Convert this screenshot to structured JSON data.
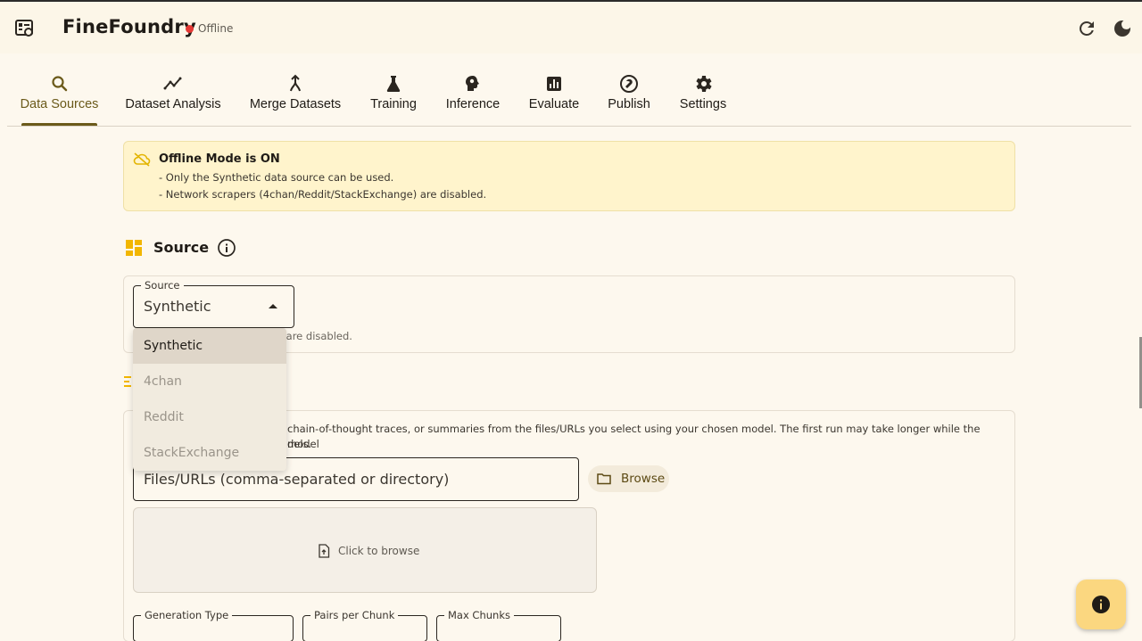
{
  "app": {
    "title": "FineFoundry",
    "status": "Offline",
    "status_color": "#e53935",
    "accent_color": "#6b5a1a",
    "icons": {
      "app": "app-logo-icon",
      "refresh": "refresh-icon",
      "theme": "dark-mode-icon"
    }
  },
  "tabs": [
    {
      "label": "Data Sources",
      "icon": "search-icon",
      "active": true
    },
    {
      "label": "Dataset Analysis",
      "icon": "trending-icon",
      "active": false
    },
    {
      "label": "Merge Datasets",
      "icon": "merge-icon",
      "active": false
    },
    {
      "label": "Training",
      "icon": "flask-icon",
      "active": false
    },
    {
      "label": "Inference",
      "icon": "brain-icon",
      "active": false
    },
    {
      "label": "Evaluate",
      "icon": "bar-chart-icon",
      "active": false
    },
    {
      "label": "Publish",
      "icon": "publish-icon",
      "active": false
    },
    {
      "label": "Settings",
      "icon": "gear-icon",
      "active": false
    }
  ],
  "banner": {
    "title": "Offline Mode is ON",
    "lines": [
      "- Only the Synthetic data source can be used.",
      "- Network scrapers (4chan/Reddit/StackExchange) are disabled."
    ],
    "background_color": "#fff4cc"
  },
  "source_section": {
    "title": "Source",
    "select_label": "Source",
    "select_value": "Synthetic",
    "helper_suffix": "s are disabled.",
    "options": [
      {
        "label": "Synthetic",
        "selected": true,
        "disabled": false
      },
      {
        "label": "4chan",
        "selected": false,
        "disabled": true
      },
      {
        "label": "Reddit",
        "selected": false,
        "disabled": true
      },
      {
        "label": "StackExchange",
        "selected": false,
        "disabled": true
      }
    ]
  },
  "generation": {
    "description_line1": "chain-of-thought traces, or summaries from the files/URLs you select using your chosen model. The first run may take longer while the model",
    "description_line2": "dels.",
    "files_placeholder": "Files/URLs (comma-separated or directory)",
    "browse_label": "Browse",
    "dropzone_label": "Click to browse",
    "fields": [
      "Generation Type",
      "Pairs per Chunk",
      "Max Chunks"
    ]
  }
}
